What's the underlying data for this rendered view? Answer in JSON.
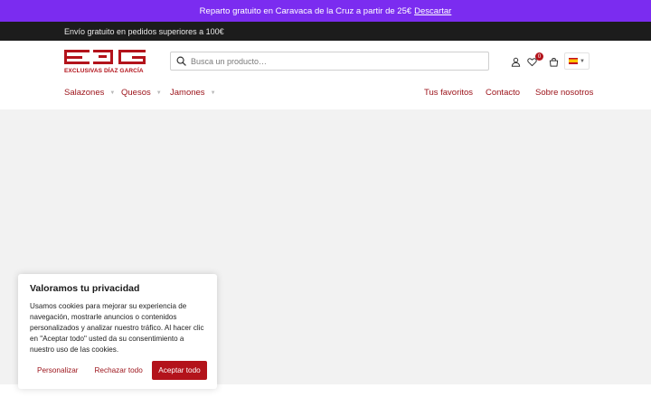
{
  "promo": {
    "text": "Reparto gratuito en Caravaca de la Cruz a partir de 25€",
    "dismiss_label": "Descartar"
  },
  "shipping": {
    "text": "Envío gratuito en pedidos superiores a 100€"
  },
  "logo": {
    "text": "EXCLUSIVAS DÍAZ GARCÍA",
    "icon": "edg-logo"
  },
  "search": {
    "placeholder": "Busca un producto…",
    "value": ""
  },
  "header_icons": {
    "user": "user-icon",
    "wishlist": "heart-icon",
    "wishlist_count": "0",
    "cart": "bag-icon"
  },
  "language": {
    "selected": "es",
    "flag": "spain-flag-icon"
  },
  "nav": {
    "left": [
      {
        "label": "Salazones"
      },
      {
        "label": "Quesos"
      },
      {
        "label": "Jamones"
      }
    ],
    "right": [
      {
        "label": "Tus favoritos"
      },
      {
        "label": "Contacto"
      },
      {
        "label": "Sobre nosotros"
      }
    ]
  },
  "cookie": {
    "title": "Valoramos tu privacidad",
    "body": "Usamos cookies para mejorar su experiencia de navegación, mostrarle anuncios o contenidos personalizados y analizar nuestro tráfico. Al hacer clic en \"Aceptar todo\" usted da su consentimiento a nuestro uso de las cookies.",
    "customize_label": "Personalizar",
    "reject_label": "Rechazar todo",
    "accept_label": "Aceptar todo"
  },
  "colors": {
    "promo_bg": "#7b2cf0",
    "shipping_bg": "#1c1c1c",
    "brand_red": "#b3131b",
    "content_bg": "#f2f2f2"
  }
}
